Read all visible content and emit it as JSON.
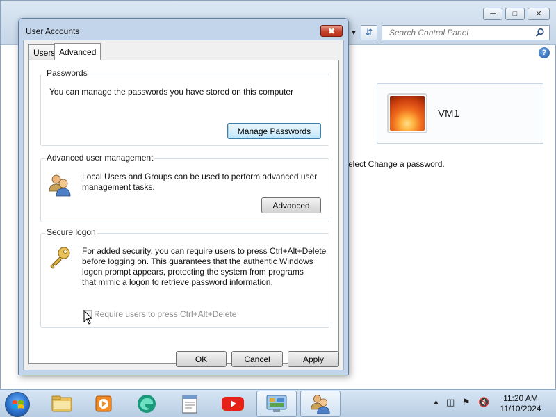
{
  "control_panel": {
    "search_placeholder": "Search Control Panel",
    "account_name": "VM1",
    "instruction_partial": "elect Change a password."
  },
  "dialog": {
    "title": "User Accounts",
    "tabs": [
      {
        "label": "Users",
        "active": false
      },
      {
        "label": "Advanced",
        "active": true
      }
    ],
    "passwords": {
      "label": "Passwords",
      "text": "You can manage the passwords you have stored on this computer",
      "button": "Manage Passwords"
    },
    "advanced_user_management": {
      "label": "Advanced user management",
      "text_line1": "Local Users and Groups can be used to perform advanced user",
      "text_line2": "management tasks.",
      "button": "Advanced"
    },
    "secure_logon": {
      "label": "Secure logon",
      "text_line1": "For added security, you can require users to press Ctrl+Alt+Delete",
      "text_line2": "before logging on. This guarantees that the authentic Windows",
      "text_line3": "logon prompt appears, protecting the system from programs",
      "text_line4": "that mimic a logon to retrieve password information.",
      "checkbox_label": "Require users to press Ctrl+Alt+Delete",
      "checkbox_checked": false,
      "checkbox_enabled": false
    },
    "buttons": {
      "ok": "OK",
      "cancel": "Cancel",
      "apply": "Apply"
    }
  },
  "taskbar": {
    "clock_time": "11:20 AM",
    "clock_date": "11/10/2024",
    "items": [
      "file-explorer-icon",
      "media-player-icon",
      "edge-browser-icon",
      "notepad-icon",
      "youtube-icon",
      "control-panel-icon",
      "user-accounts-icon"
    ]
  },
  "colors": {
    "dialog_frame": "#c3d5ea",
    "close_button": "#c6422d",
    "taskbar": "#b8cde3"
  }
}
